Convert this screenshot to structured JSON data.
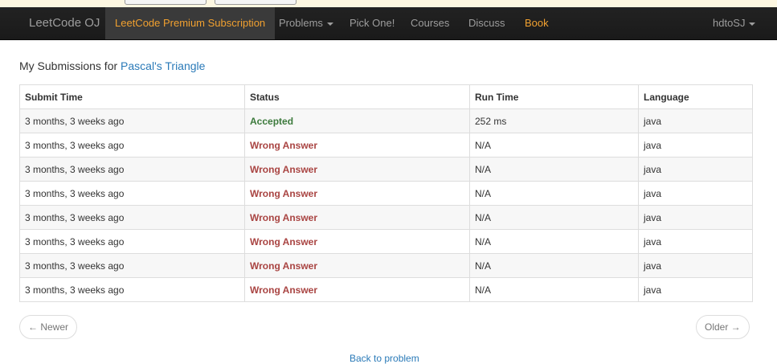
{
  "navbar": {
    "brand": "LeetCode OJ",
    "premium": "LeetCode Premium Subscription",
    "problems": "Problems",
    "pick_one": "Pick One!",
    "courses": "Courses",
    "discuss": "Discuss",
    "book": "Book",
    "user": "hdtoSJ",
    "accent_color": "#f0a030"
  },
  "heading": {
    "prefix": "My Submissions for",
    "problem": "Pascal's Triangle"
  },
  "table": {
    "headers": [
      "Submit Time",
      "Status",
      "Run Time",
      "Language"
    ],
    "rows": [
      {
        "time": "3 months, 3 weeks ago",
        "status": "Accepted",
        "runtime": "252 ms",
        "language": "java"
      },
      {
        "time": "3 months, 3 weeks ago",
        "status": "Wrong Answer",
        "runtime": "N/A",
        "language": "java"
      },
      {
        "time": "3 months, 3 weeks ago",
        "status": "Wrong Answer",
        "runtime": "N/A",
        "language": "java"
      },
      {
        "time": "3 months, 3 weeks ago",
        "status": "Wrong Answer",
        "runtime": "N/A",
        "language": "java"
      },
      {
        "time": "3 months, 3 weeks ago",
        "status": "Wrong Answer",
        "runtime": "N/A",
        "language": "java"
      },
      {
        "time": "3 months, 3 weeks ago",
        "status": "Wrong Answer",
        "runtime": "N/A",
        "language": "java"
      },
      {
        "time": "3 months, 3 weeks ago",
        "status": "Wrong Answer",
        "runtime": "N/A",
        "language": "java"
      },
      {
        "time": "3 months, 3 weeks ago",
        "status": "Wrong Answer",
        "runtime": "N/A",
        "language": "java"
      }
    ]
  },
  "pager": {
    "newer": "← Newer",
    "older": "Older →"
  },
  "back_link": "Back to problem"
}
